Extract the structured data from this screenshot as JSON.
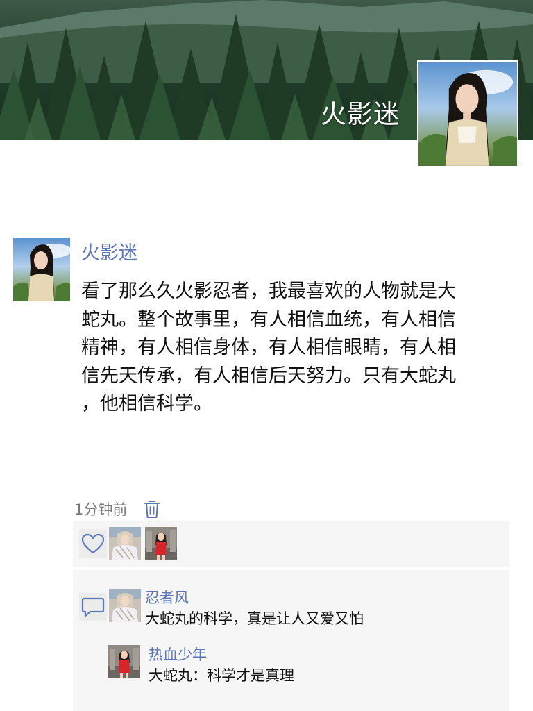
{
  "cover": {
    "username": "火影迷"
  },
  "post": {
    "author": "火影迷",
    "lines": [
      "看了那么久火影忍者，我最喜欢的人物就是大",
      "蛇丸。整个故事里，有人相信血统，有人相信",
      "精神，有人相信身体，有人相信眼睛，有人相",
      "信先天传承，有人相信后天努力。只有大蛇丸",
      "，他相信科学。"
    ],
    "time": "1分钟前",
    "delete_icon": "trash-icon"
  },
  "likes": {
    "icon": "heart-icon",
    "count_avatars": 2
  },
  "comments": {
    "icon": "comment-bubble-icon",
    "items": [
      {
        "author": "忍者风",
        "text": "大蛇丸的科学，真是让人又爱又怕"
      },
      {
        "author": "热血少年",
        "text": "大蛇丸：科学才是真理"
      }
    ]
  },
  "colors": {
    "link_blue": "#5b77b8",
    "panel_bg": "#f6f6f6",
    "time_gray": "#7a7a7a",
    "text": "#111111"
  }
}
